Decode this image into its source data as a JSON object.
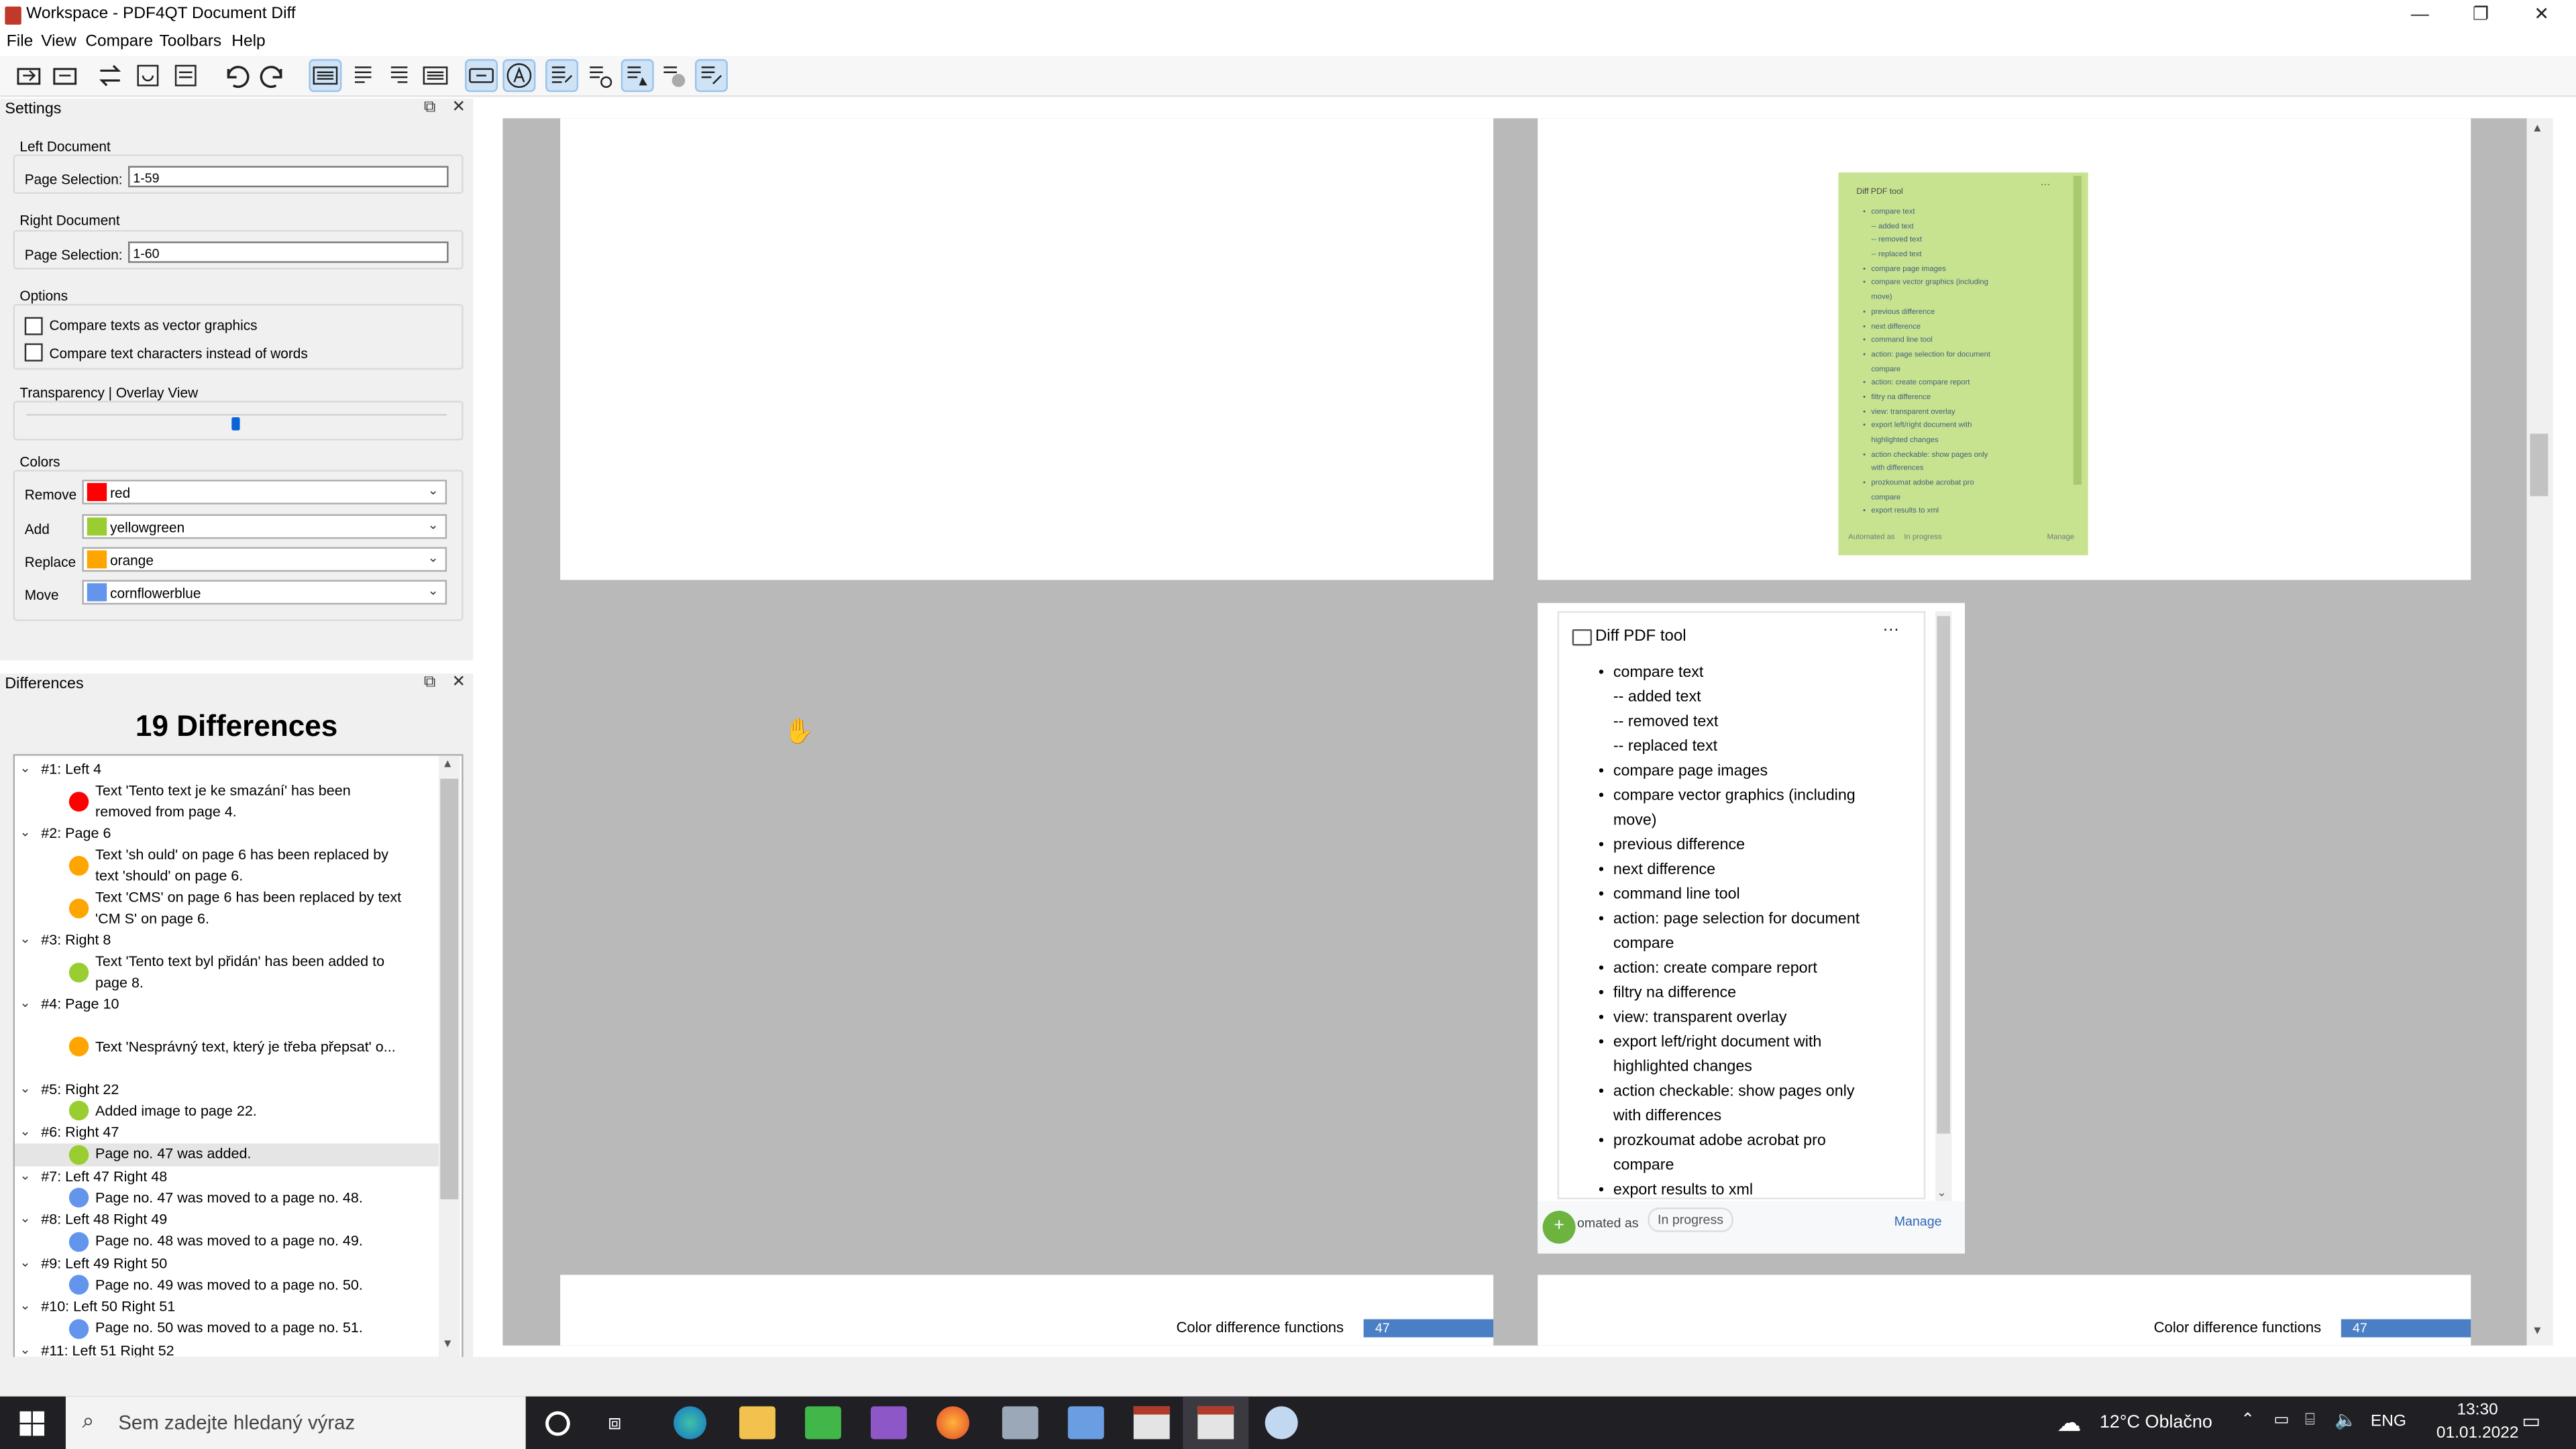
{
  "window": {
    "title": "Workspace - PDF4QT Document Diff",
    "minimize": "—",
    "maximize": "❐",
    "close": "✕"
  },
  "menu": [
    "File",
    "View",
    "Compare",
    "Toolbars",
    "Help"
  ],
  "settings": {
    "title": "Settings",
    "left_document": "Left Document",
    "left_page_selection_label": "Page Selection:",
    "left_page_selection": "1-59",
    "right_document": "Right Document",
    "right_page_selection_label": "Page Selection:",
    "right_page_selection": "1-60",
    "options_label": "Options",
    "option_vector": "Compare texts as vector graphics",
    "option_chars": "Compare text characters instead of words",
    "transparency_label": "Transparency | Overlay View",
    "transparency_value": 0.5,
    "colors_label": "Colors",
    "colors": [
      {
        "label": "Remove",
        "value": "red",
        "color": "#ff0000"
      },
      {
        "label": "Add",
        "value": "yellowgreen",
        "color": "#9acd32"
      },
      {
        "label": "Replace",
        "value": "orange",
        "color": "#ffa500"
      },
      {
        "label": "Move",
        "value": "cornflowerblue",
        "color": "#6495ed"
      }
    ]
  },
  "differences": {
    "title": "Differences",
    "count_heading": "19 Differences",
    "rows": [
      {
        "kind": "group",
        "text": "#1: Left 4"
      },
      {
        "kind": "item",
        "color": "#ff0000",
        "lines": [
          "Text 'Tento text je ke smazání' has been",
          "removed from page 4."
        ]
      },
      {
        "kind": "group",
        "text": "#2: Page 6"
      },
      {
        "kind": "item",
        "color": "#ffa500",
        "lines": [
          "Text 'sh ould' on page 6 has been replaced by",
          "text 'should' on page 6."
        ]
      },
      {
        "kind": "item",
        "color": "#ffa500",
        "lines": [
          "Text 'CMS' on page 6 has been replaced by text",
          "'CM S' on page 6."
        ]
      },
      {
        "kind": "group",
        "text": "#3: Right 8"
      },
      {
        "kind": "item",
        "color": "#9acd32",
        "lines": [
          "Text 'Tento text byl přidán' has been added to",
          "page 8."
        ]
      },
      {
        "kind": "group",
        "text": "#4: Page 10"
      },
      {
        "kind": "item",
        "color": "#ffa500",
        "lines": [
          "",
          "Text 'Nesprávný text, který je třeba přepsat' o...",
          ""
        ]
      },
      {
        "kind": "group",
        "text": "#5: Right 22"
      },
      {
        "kind": "item",
        "color": "#9acd32",
        "lines": [
          "Added image to page 22."
        ]
      },
      {
        "kind": "group",
        "text": "#6: Right 47"
      },
      {
        "kind": "item",
        "color": "#9acd32",
        "lines": [
          "Page no. 47 was added."
        ],
        "selected": true
      },
      {
        "kind": "group",
        "text": "#7: Left 47 Right 48"
      },
      {
        "kind": "item",
        "color": "#6495ed",
        "lines": [
          "Page no. 47 was moved to a page no. 48."
        ]
      },
      {
        "kind": "group",
        "text": "#8: Left 48 Right 49"
      },
      {
        "kind": "item",
        "color": "#6495ed",
        "lines": [
          "Page no. 48 was moved to a page no. 49."
        ]
      },
      {
        "kind": "group",
        "text": "#9: Left 49 Right 50"
      },
      {
        "kind": "item",
        "color": "#6495ed",
        "lines": [
          "Page no. 49 was moved to a page no. 50."
        ]
      },
      {
        "kind": "group",
        "text": "#10: Left 50 Right 51"
      },
      {
        "kind": "item",
        "color": "#6495ed",
        "lines": [
          "Page no. 50 was moved to a page no. 51."
        ]
      },
      {
        "kind": "group",
        "text": "#11: Left 51 Right 52"
      }
    ]
  },
  "card": {
    "title": "Diff PDF tool",
    "more": "···",
    "items": [
      {
        "b": "•",
        "t": "compare text"
      },
      {
        "b": "",
        "t": "-- added text"
      },
      {
        "b": "",
        "t": "-- removed text"
      },
      {
        "b": "",
        "t": "-- replaced text"
      },
      {
        "b": "•",
        "t": "compare page images"
      },
      {
        "b": "•",
        "t": "compare vector graphics (including"
      },
      {
        "b": "",
        "t": "move)"
      },
      {
        "b": "•",
        "t": "previous difference"
      },
      {
        "b": "•",
        "t": "next difference"
      },
      {
        "b": "•",
        "t": "command line tool"
      },
      {
        "b": "•",
        "t": "action: page selection for document"
      },
      {
        "b": "",
        "t": "compare"
      },
      {
        "b": "•",
        "t": "action: create compare report"
      },
      {
        "b": "•",
        "t": "filtry na difference"
      },
      {
        "b": "•",
        "t": "view: transparent overlay"
      },
      {
        "b": "•",
        "t": "export left/right document with"
      },
      {
        "b": "",
        "t": "highlighted changes"
      },
      {
        "b": "•",
        "t": "action checkable: show pages only"
      },
      {
        "b": "",
        "t": "with differences"
      },
      {
        "b": "•",
        "t": "prozkoumat adobe acrobat pro"
      },
      {
        "b": "",
        "t": "compare"
      },
      {
        "b": "•",
        "t": "export results to xml"
      }
    ],
    "footer_automated": "omated as",
    "footer_status": "In progress",
    "footer_manage": "Manage",
    "thumb_automated": "Automated as",
    "thumb_status": "In progress",
    "thumb_manage": "Manage"
  },
  "page_footer": {
    "text": "Color difference functions",
    "number": "47"
  },
  "taskbar": {
    "search_placeholder": "Sem zadejte hledaný výraz",
    "weather": "12°C Oblačno",
    "lang": "ENG",
    "time": "13:30",
    "date": "01.01.2022"
  }
}
